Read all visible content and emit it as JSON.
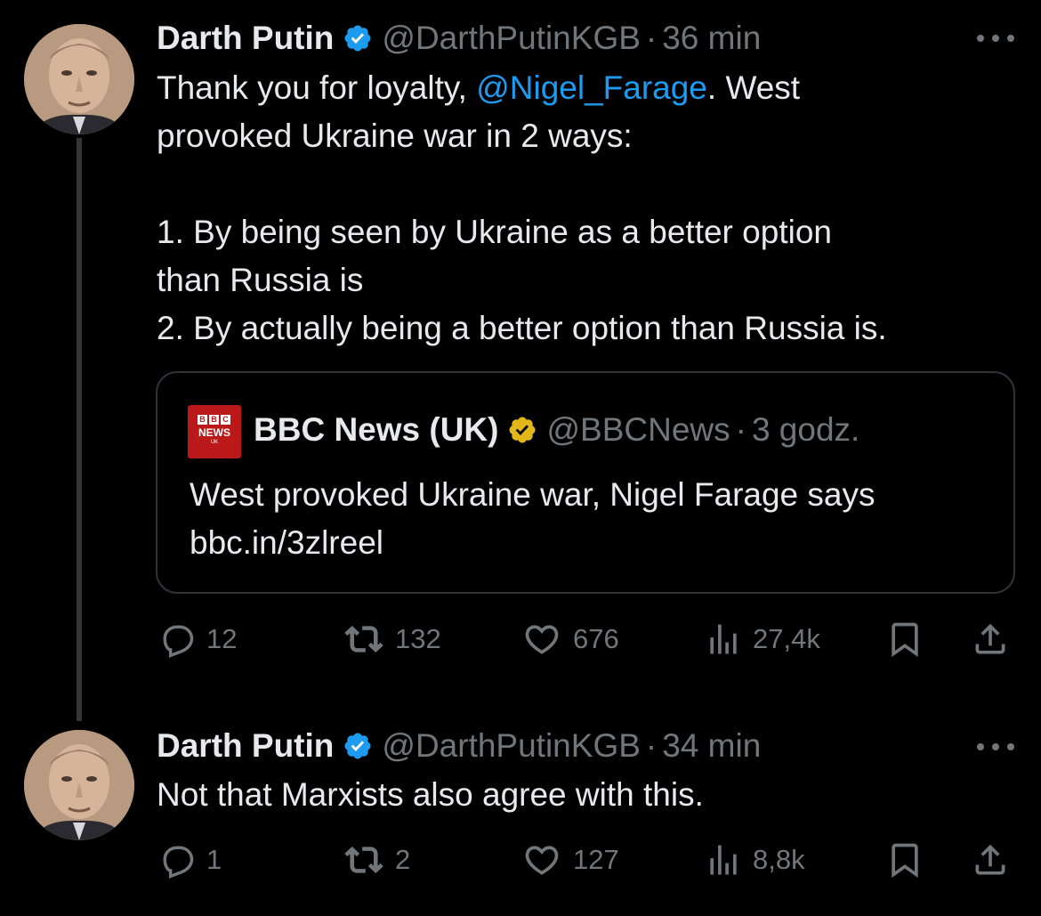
{
  "tweet1": {
    "name": "Darth Putin",
    "handle": "@DarthPutinKGB",
    "dot": "·",
    "time": "36 min",
    "text_before_mention": "Thank you for loyalty, ",
    "mention": "@Nigel_Farage",
    "text_after_mention": ". West\nprovoked Ukraine war in 2 ways:\n\n1. By being seen by Ukraine as a better option\nthan Russia is\n2. By actually being a better option than Russia is.",
    "quote": {
      "logo_letters": [
        "B",
        "B",
        "C"
      ],
      "logo_word": "NEWS",
      "logo_sub": "UK",
      "name": "BBC News (UK)",
      "handle": "@BBCNews",
      "dot": "·",
      "time": "3 godz.",
      "text": "West provoked Ukraine war, Nigel Farage says\nbbc.in/3zlreel"
    },
    "stats": {
      "replies": "12",
      "reposts": "132",
      "likes": "676",
      "views": "27,4k"
    }
  },
  "tweet2": {
    "name": "Darth Putin",
    "handle": "@DarthPutinKGB",
    "dot": "·",
    "time": "34 min",
    "text": "Not that Marxists also agree with this.",
    "stats": {
      "replies": "1",
      "reposts": "2",
      "likes": "127",
      "views": "8,8k"
    }
  },
  "colors": {
    "background": "#000000",
    "text": "#e7e9ea",
    "muted": "#71767b",
    "link": "#1d9bf0",
    "verified_blue": "#1d9bf0",
    "verified_gold": "#e2b719",
    "bbc_red": "#bb1919"
  },
  "icons": [
    "verified-badge-icon",
    "more-icon",
    "reply-icon",
    "repost-icon",
    "like-icon",
    "views-icon",
    "bookmark-icon",
    "share-icon"
  ]
}
